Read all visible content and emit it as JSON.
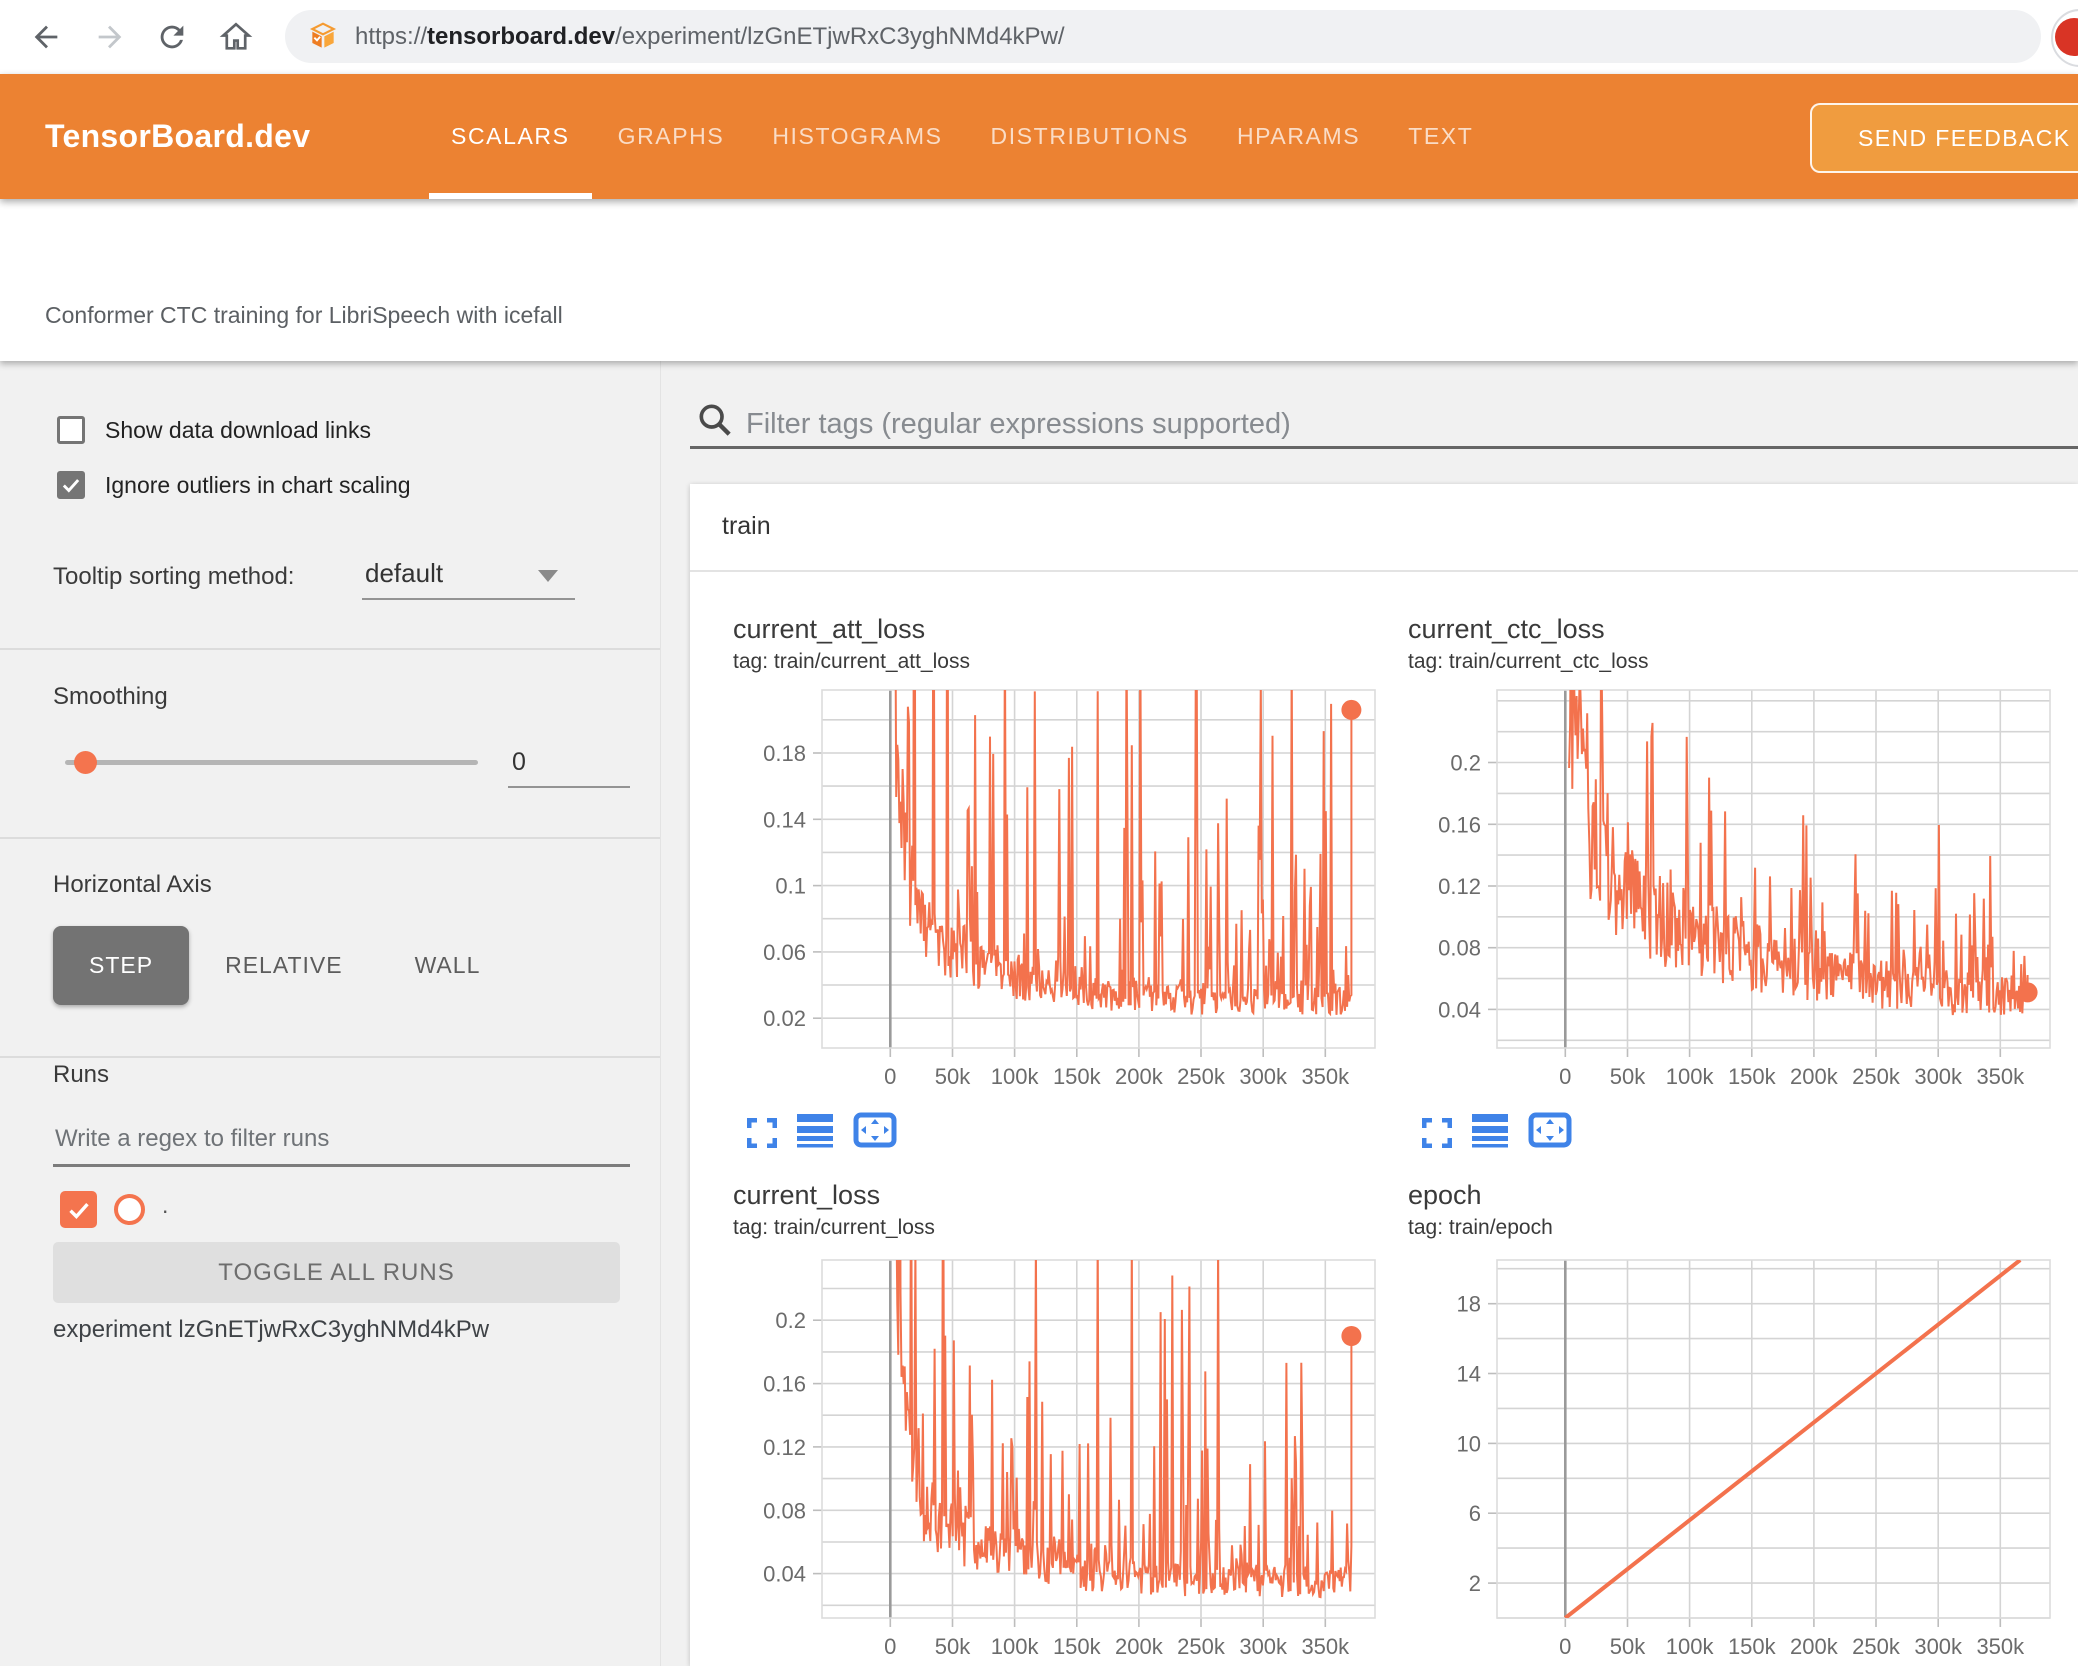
{
  "colors": {
    "header_orange": "#ec8232",
    "feedback_orange": "#f09c3f",
    "accent_orange": "#f4744e",
    "chart_line": "#f3724d",
    "icon_blue": "#3f83e8",
    "grid_gray": "#d4d4d4",
    "zero_axis_gray": "#9a9a9a"
  },
  "browser": {
    "url_scheme": "https://",
    "url_domain": "tensorboard.dev",
    "url_path": "/experiment/lzGnETjwRxC3yghNMd4kPw/"
  },
  "header": {
    "logo": "TensorBoard.dev",
    "tabs": [
      {
        "label": "SCALARS",
        "active": true
      },
      {
        "label": "GRAPHS",
        "active": false
      },
      {
        "label": "HISTOGRAMS",
        "active": false
      },
      {
        "label": "DISTRIBUTIONS",
        "active": false
      },
      {
        "label": "HPARAMS",
        "active": false
      },
      {
        "label": "TEXT",
        "active": false
      }
    ],
    "feedback_label": "SEND FEEDBACK"
  },
  "subtitle": "Conformer CTC training for LibriSpeech with icefall",
  "sidebar": {
    "checkboxes": [
      {
        "label": "Show data download links",
        "checked": false
      },
      {
        "label": "Ignore outliers in chart scaling",
        "checked": true
      }
    ],
    "tooltip_sorting": {
      "label": "Tooltip sorting method:",
      "value": "default"
    },
    "smoothing": {
      "label": "Smoothing",
      "value": "0"
    },
    "horizontal_axis": {
      "label": "Horizontal Axis",
      "options": [
        {
          "label": "STEP",
          "active": true
        },
        {
          "label": "RELATIVE",
          "active": false
        },
        {
          "label": "WALL",
          "active": false
        }
      ]
    },
    "runs": {
      "label": "Runs",
      "filter_placeholder": "Write a regex to filter runs",
      "run_item": {
        "name": ".",
        "checked": true
      },
      "toggle_button": "TOGGLE ALL RUNS",
      "experiment": "experiment lzGnETjwRxC3yghNMd4kPw"
    }
  },
  "main": {
    "filter_placeholder": "Filter tags (regular expressions supported)",
    "section": "train"
  },
  "chart_data": [
    {
      "type": "line",
      "title": "current_att_loss",
      "tag": "tag: train/current_att_loss",
      "xlabel": "step",
      "x_range": [
        -55000,
        390000
      ],
      "y_range": [
        0.002,
        0.218
      ],
      "y_grid_step": 0.02,
      "x_ticks": [
        {
          "v": 0,
          "label": "0"
        },
        {
          "v": 50000,
          "label": "50k"
        },
        {
          "v": 100000,
          "label": "100k"
        },
        {
          "v": 150000,
          "label": "150k"
        },
        {
          "v": 200000,
          "label": "200k"
        },
        {
          "v": 250000,
          "label": "250k"
        },
        {
          "v": 300000,
          "label": "300k"
        },
        {
          "v": 350000,
          "label": "350k"
        }
      ],
      "y_ticks": [
        {
          "v": 0.02,
          "label": "0.02"
        },
        {
          "v": 0.06,
          "label": "0.06"
        },
        {
          "v": 0.1,
          "label": "0.1"
        },
        {
          "v": 0.14,
          "label": "0.14"
        },
        {
          "v": 0.18,
          "label": "0.18"
        }
      ],
      "series": {
        "kind": "noisy",
        "seed": 11,
        "n": 430,
        "x_start": 3000,
        "x_end": 371000,
        "baseline": [
          [
            3000,
            0.22
          ],
          [
            12000,
            0.115
          ],
          [
            25000,
            0.075
          ],
          [
            45000,
            0.06
          ],
          [
            70000,
            0.05
          ],
          [
            110000,
            0.042
          ],
          [
            150000,
            0.036
          ],
          [
            200000,
            0.032
          ],
          [
            260000,
            0.03
          ],
          [
            320000,
            0.031
          ],
          [
            371000,
            0.03
          ]
        ],
        "spike_env": [
          [
            3000,
            0.6
          ],
          [
            30000,
            0.45
          ],
          [
            70000,
            0.34
          ],
          [
            120000,
            0.28
          ],
          [
            180000,
            0.26
          ],
          [
            250000,
            0.25
          ],
          [
            371000,
            0.28
          ]
        ],
        "jitter": 0.28,
        "tail_power": 9,
        "end_dot": [
          371000,
          0.206
        ]
      }
    },
    {
      "type": "line",
      "title": "current_ctc_loss",
      "tag": "tag: train/current_ctc_loss",
      "xlabel": "step",
      "x_range": [
        -55000,
        390000
      ],
      "y_range": [
        0.015,
        0.247
      ],
      "y_grid_step": 0.02,
      "x_ticks": [
        {
          "v": 0,
          "label": "0"
        },
        {
          "v": 50000,
          "label": "50k"
        },
        {
          "v": 100000,
          "label": "100k"
        },
        {
          "v": 150000,
          "label": "150k"
        },
        {
          "v": 200000,
          "label": "200k"
        },
        {
          "v": 250000,
          "label": "250k"
        },
        {
          "v": 300000,
          "label": "300k"
        },
        {
          "v": 350000,
          "label": "350k"
        }
      ],
      "y_ticks": [
        {
          "v": 0.04,
          "label": "0.04"
        },
        {
          "v": 0.08,
          "label": "0.08"
        },
        {
          "v": 0.12,
          "label": "0.12"
        },
        {
          "v": 0.16,
          "label": "0.16"
        },
        {
          "v": 0.2,
          "label": "0.2"
        }
      ],
      "series": {
        "kind": "noisy",
        "seed": 23,
        "n": 430,
        "x_start": 3000,
        "x_end": 372000,
        "baseline": [
          [
            3000,
            0.26
          ],
          [
            15000,
            0.17
          ],
          [
            30000,
            0.135
          ],
          [
            50000,
            0.115
          ],
          [
            75000,
            0.098
          ],
          [
            110000,
            0.085
          ],
          [
            150000,
            0.074
          ],
          [
            200000,
            0.063
          ],
          [
            250000,
            0.056
          ],
          [
            300000,
            0.052
          ],
          [
            372000,
            0.05
          ]
        ],
        "spike_env": [
          [
            3000,
            0.55
          ],
          [
            25000,
            0.4
          ],
          [
            50000,
            0.3
          ],
          [
            90000,
            0.24
          ],
          [
            140000,
            0.2
          ],
          [
            200000,
            0.17
          ],
          [
            280000,
            0.17
          ],
          [
            372000,
            0.17
          ]
        ],
        "jitter": 0.3,
        "tail_power": 9,
        "end_dot": [
          372000,
          0.051
        ]
      }
    },
    {
      "type": "line",
      "title": "current_loss",
      "tag": "tag: train/current_loss",
      "xlabel": "step",
      "x_range": [
        -55000,
        390000
      ],
      "y_range": [
        0.012,
        0.238
      ],
      "y_grid_step": 0.02,
      "x_ticks": [
        {
          "v": 0,
          "label": "0"
        },
        {
          "v": 50000,
          "label": "50k"
        },
        {
          "v": 100000,
          "label": "100k"
        },
        {
          "v": 150000,
          "label": "150k"
        },
        {
          "v": 200000,
          "label": "200k"
        },
        {
          "v": 250000,
          "label": "250k"
        },
        {
          "v": 300000,
          "label": "300k"
        },
        {
          "v": 350000,
          "label": "350k"
        }
      ],
      "y_ticks": [
        {
          "v": 0.04,
          "label": "0.04"
        },
        {
          "v": 0.08,
          "label": "0.08"
        },
        {
          "v": 0.12,
          "label": "0.12"
        },
        {
          "v": 0.16,
          "label": "0.16"
        },
        {
          "v": 0.2,
          "label": "0.2"
        }
      ],
      "series": {
        "kind": "noisy",
        "seed": 37,
        "n": 430,
        "x_start": 3000,
        "x_end": 371000,
        "baseline": [
          [
            3000,
            0.24
          ],
          [
            12000,
            0.13
          ],
          [
            25000,
            0.085
          ],
          [
            45000,
            0.068
          ],
          [
            70000,
            0.057
          ],
          [
            110000,
            0.048
          ],
          [
            150000,
            0.041
          ],
          [
            200000,
            0.037
          ],
          [
            260000,
            0.034
          ],
          [
            320000,
            0.035
          ],
          [
            371000,
            0.034
          ]
        ],
        "spike_env": [
          [
            3000,
            0.6
          ],
          [
            30000,
            0.47
          ],
          [
            70000,
            0.36
          ],
          [
            120000,
            0.3
          ],
          [
            180000,
            0.28
          ],
          [
            250000,
            0.27
          ],
          [
            371000,
            0.3
          ]
        ],
        "jitter": 0.28,
        "tail_power": 9,
        "end_dot": [
          371000,
          0.19
        ]
      }
    },
    {
      "type": "line",
      "title": "epoch",
      "tag": "tag: train/epoch",
      "xlabel": "step",
      "x_range": [
        -55000,
        390000
      ],
      "y_range": [
        0,
        20.5
      ],
      "y_grid_step": 2,
      "x_ticks": [
        {
          "v": 0,
          "label": "0"
        },
        {
          "v": 50000,
          "label": "50k"
        },
        {
          "v": 100000,
          "label": "100k"
        },
        {
          "v": 150000,
          "label": "150k"
        },
        {
          "v": 200000,
          "label": "200k"
        },
        {
          "v": 250000,
          "label": "250k"
        },
        {
          "v": 300000,
          "label": "300k"
        },
        {
          "v": 350000,
          "label": "350k"
        }
      ],
      "y_ticks": [
        {
          "v": 2,
          "label": "2"
        },
        {
          "v": 6,
          "label": "6"
        },
        {
          "v": 10,
          "label": "10"
        },
        {
          "v": 14,
          "label": "14"
        },
        {
          "v": 18,
          "label": "18"
        }
      ],
      "series": {
        "kind": "line",
        "points": [
          [
            0,
            0
          ],
          [
            366000,
            20.5
          ]
        ]
      }
    }
  ]
}
